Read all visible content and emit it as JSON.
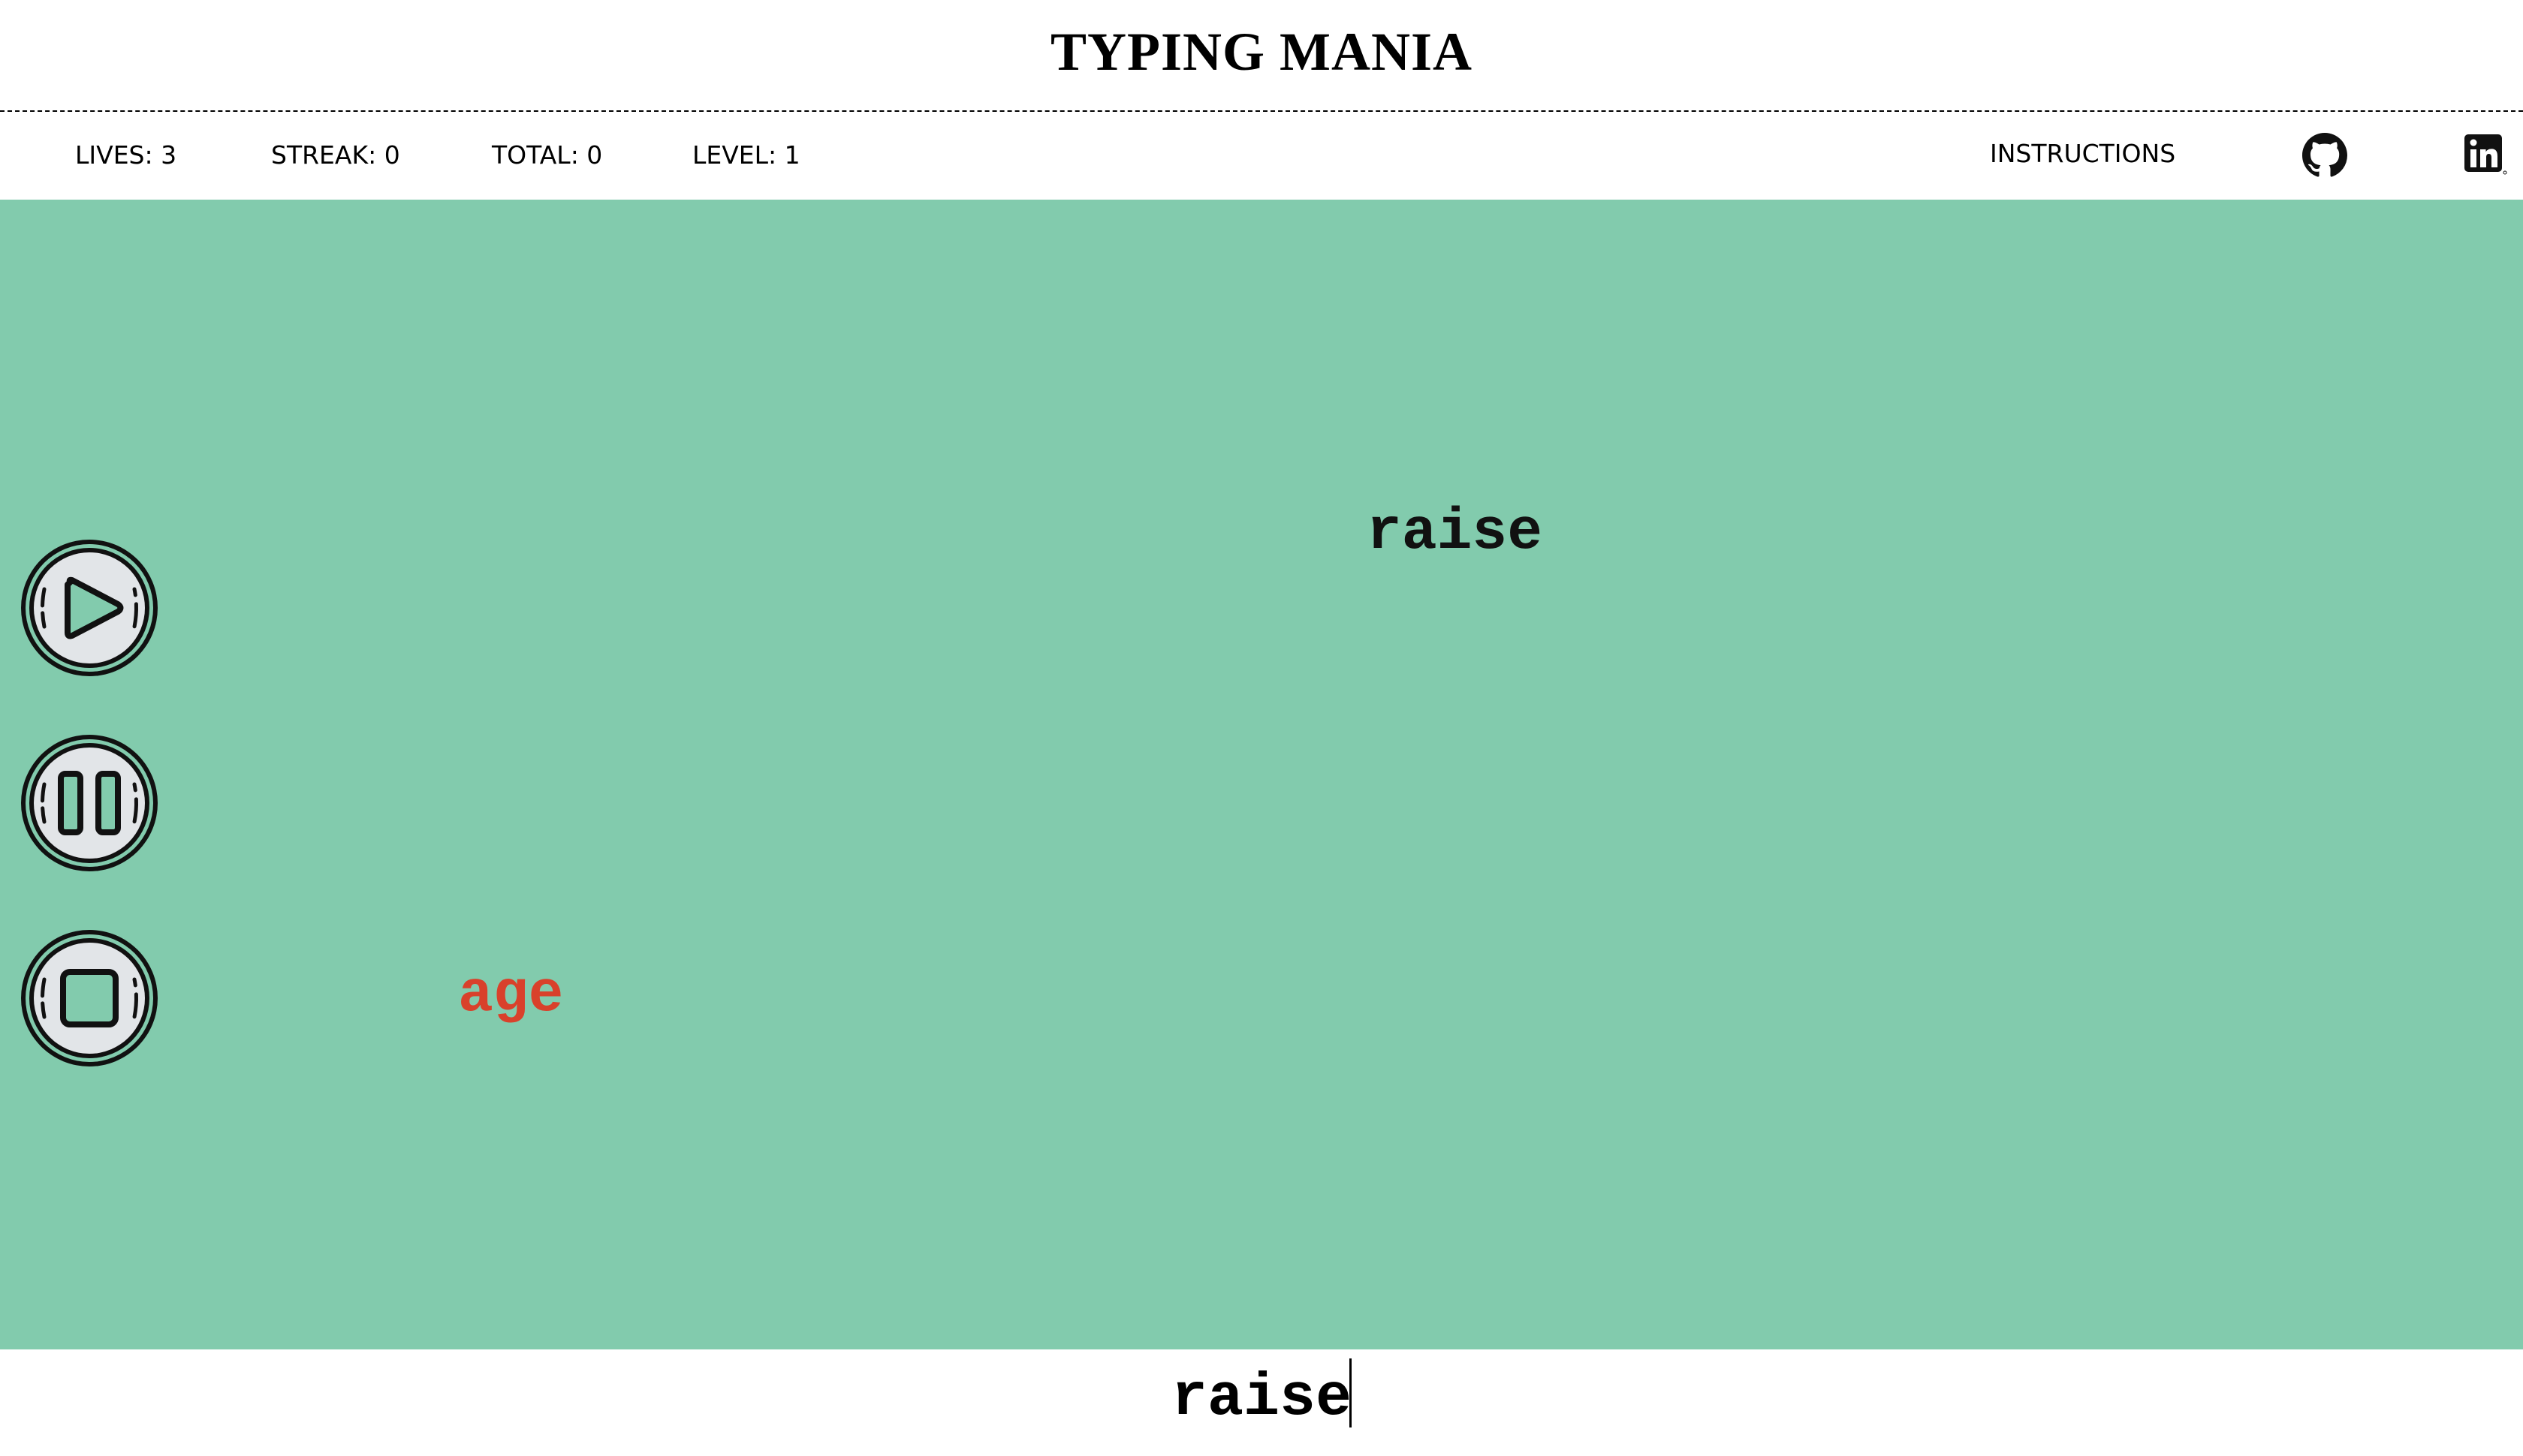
{
  "header": {
    "title": "TYPING MANIA"
  },
  "stats": {
    "lives": "LIVES: 3",
    "streak": "STREAK: 0",
    "total": "TOTAL: 0",
    "level": "LEVEL: 1"
  },
  "nav": {
    "instructions_label": "INSTRUCTIONS",
    "icons": [
      "github-icon",
      "linkedin-icon"
    ]
  },
  "controls": {
    "icons": [
      "play-icon",
      "pause-icon",
      "stop-icon"
    ]
  },
  "falling_words": [
    {
      "text": "raise",
      "color": "#111111"
    },
    {
      "text": "age",
      "color": "#d9412b"
    }
  ],
  "input": {
    "value": "raise"
  },
  "colors": {
    "game_background": "#82cbad",
    "highlight_word": "#d9412b",
    "button_face": "#e2e5e8"
  }
}
